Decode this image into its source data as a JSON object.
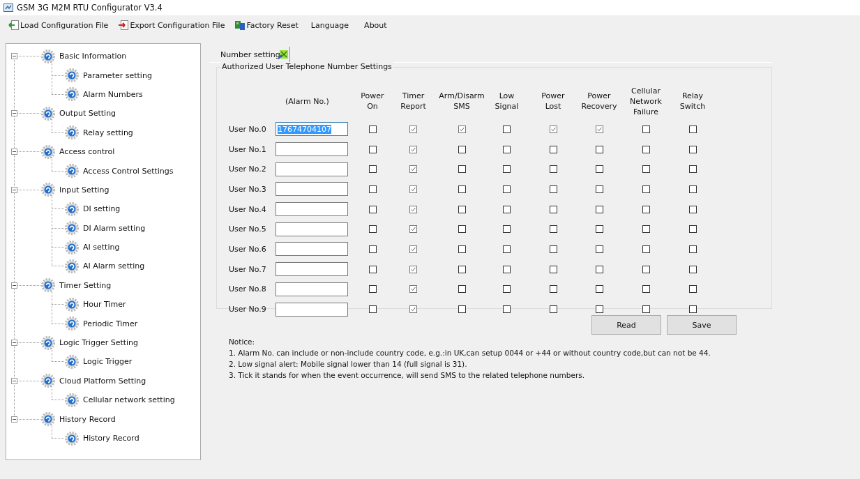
{
  "window": {
    "title": "GSM 3G M2M RTU Configurator V3.4"
  },
  "toolbar": [
    {
      "kind": "load",
      "label": "Load Configuration File"
    },
    {
      "kind": "export",
      "label": "Export Configuration File"
    },
    {
      "kind": "reset",
      "label": "Factory Reset"
    },
    {
      "kind": "plain",
      "label": "Language"
    },
    {
      "kind": "plain",
      "label": "About"
    }
  ],
  "sidebar": {
    "items": [
      {
        "label": "Basic Information",
        "expanded": true,
        "children": [
          {
            "label": "Parameter setting"
          },
          {
            "label": "Alarm Numbers"
          }
        ]
      },
      {
        "label": "Output Setting",
        "expanded": true,
        "children": [
          {
            "label": "Relay setting"
          }
        ]
      },
      {
        "label": "Access control",
        "expanded": true,
        "children": [
          {
            "label": "Access Control Settings"
          }
        ]
      },
      {
        "label": "Input Setting",
        "expanded": true,
        "children": [
          {
            "label": "DI setting"
          },
          {
            "label": "DI Alarm setting"
          },
          {
            "label": "AI setting"
          },
          {
            "label": "AI Alarm setting"
          }
        ]
      },
      {
        "label": "Timer Setting",
        "expanded": true,
        "children": [
          {
            "label": "Hour Timer"
          },
          {
            "label": "Periodic Timer"
          }
        ]
      },
      {
        "label": "Logic Trigger Setting",
        "expanded": true,
        "children": [
          {
            "label": "Logic Trigger"
          }
        ]
      },
      {
        "label": "Cloud Platform Setting",
        "expanded": true,
        "children": [
          {
            "label": "Cellular network setting"
          }
        ]
      },
      {
        "label": "History Record",
        "expanded": true,
        "children": [
          {
            "label": "History Record"
          }
        ]
      }
    ]
  },
  "tabs": [
    {
      "label": "Number setting",
      "selected": true
    }
  ],
  "group": {
    "title": "Authorized User Telephone Number Settings",
    "columns": [
      "(Alarm No.)",
      "Power\nOn",
      "Timer\nReport",
      "Arm/Disarm\nSMS",
      "Low\nSignal",
      "Power\nLost",
      "Power\nRecovery",
      "Cellular\nNetwork\nFailure",
      "Relay\nSwitch"
    ],
    "rows": [
      {
        "label": "User No.0",
        "number": "17674704107",
        "number_selected": true,
        "checks": [
          false,
          true,
          true,
          false,
          true,
          true,
          false,
          false
        ]
      },
      {
        "label": "User No.1",
        "checks": [
          false,
          true,
          false,
          false,
          false,
          false,
          false,
          false
        ]
      },
      {
        "label": "User No.2",
        "checks": [
          false,
          true,
          false,
          false,
          false,
          false,
          false,
          false
        ]
      },
      {
        "label": "User No.3",
        "checks": [
          false,
          true,
          false,
          false,
          false,
          false,
          false,
          false
        ]
      },
      {
        "label": "User No.4",
        "checks": [
          false,
          true,
          false,
          false,
          false,
          false,
          false,
          false
        ]
      },
      {
        "label": "User No.5",
        "checks": [
          false,
          true,
          false,
          false,
          false,
          false,
          false,
          false
        ]
      },
      {
        "label": "User No.6",
        "checks": [
          false,
          true,
          false,
          false,
          false,
          false,
          false,
          false
        ]
      },
      {
        "label": "User No.7",
        "checks": [
          false,
          true,
          false,
          false,
          false,
          false,
          false,
          false
        ]
      },
      {
        "label": "User No.8",
        "checks": [
          false,
          true,
          false,
          false,
          false,
          false,
          false,
          false
        ]
      },
      {
        "label": "User No.9",
        "checks": [
          false,
          true,
          false,
          false,
          false,
          false,
          false,
          false
        ]
      }
    ]
  },
  "buttons": [
    "Read",
    "Save"
  ],
  "notice": [
    "Notice:",
    "1. Alarm No. can include or non-include country code, e.g.:in UK,can setup 0044 or +44 or without country code,but can not be 44.",
    "2. Low signal alert: Mobile signal lower than 14 (full signal is 31).",
    "3. Tick it stands for when the event occurrence, will send SMS to the related telephone numbers."
  ]
}
